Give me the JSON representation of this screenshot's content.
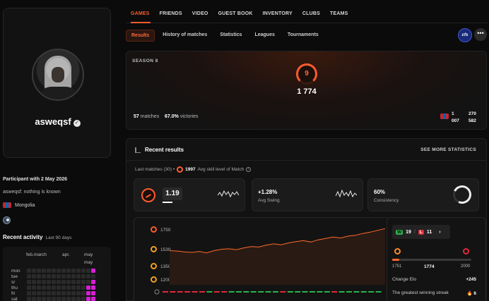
{
  "profile": {
    "username": "asweqsf",
    "participant": "Participant with 2 May 2026",
    "status": "asweqsf: nothing is known",
    "country": "Mongolia"
  },
  "activity": {
    "title": "Recent activity",
    "subtitle": "Last 90 days",
    "months": [
      "feb.march",
      "apr.",
      "may"
    ],
    "month_extra": "may",
    "days": [
      "mon",
      "tue",
      "sr",
      "thu",
      "fri",
      "sat",
      "sun"
    ],
    "accent": "#d61ed6"
  },
  "nav": {
    "items": [
      "GAMES",
      "FRIENDS",
      "VIDEO",
      "GUEST BOOK",
      "INVENTORY",
      "CLUBS",
      "TEAMS"
    ],
    "active_color": "#ff5b2e"
  },
  "subtabs": [
    "Results",
    "History of matches",
    "Statistics",
    "Leagues",
    "Tournaments"
  ],
  "team_logo": "cfs",
  "more_label": "•••",
  "season": {
    "label": "SEASON 8",
    "level": "9",
    "elo": "1 774",
    "matches_value": "57",
    "matches_label": "matches",
    "victories_value": "67.0%",
    "victories_label": "victories",
    "right_line1_a": "1",
    "right_line1_b": "270",
    "right_line2_a": "007",
    "right_line2_b": "582"
  },
  "results": {
    "title": "Recent results",
    "see_more": "SEE MORE STATISTICS",
    "last_matches_prefix": "Last matches (30) •",
    "avg_value": "1997",
    "avg_label": "Avg skill level of Match",
    "elo_card_value": "1.19",
    "swing_value": "+1.28%",
    "swing_label": "Avg Swing",
    "consistency_value": "60%",
    "consistency_label": "Consistency"
  },
  "chart_data": {
    "type": "area",
    "y_ticks": [
      "1750",
      "1530",
      "1350",
      "1200"
    ],
    "ylim": [
      1150,
      1800
    ],
    "values": [
      1530,
      1525,
      1515,
      1510,
      1520,
      1505,
      1530,
      1545,
      1550,
      1540,
      1560,
      1575,
      1570,
      1590,
      1605,
      1595,
      1615,
      1630,
      1640,
      1625,
      1650,
      1665,
      1680,
      1670,
      1690,
      1700,
      1720,
      1735,
      1755,
      1774
    ],
    "results": [
      "L",
      "L",
      "L",
      "L",
      "L",
      "L",
      "W",
      "L",
      "L",
      "W",
      "W",
      "W",
      "W",
      "W",
      "W",
      "W",
      "L",
      "W",
      "W",
      "W",
      "W",
      "W",
      "W",
      "L",
      "W",
      "W",
      "W",
      "W",
      "W",
      "W"
    ],
    "line_color": "#ff6a2a",
    "win_color": "#2bb24c",
    "loss_color": "#e0283a"
  },
  "side": {
    "wins": "19",
    "losses": "11",
    "chevron": "›",
    "range_min": "1751",
    "range_current": "1774",
    "range_max": "2000",
    "range_fraction": 0.09,
    "change_label": "Change Elo",
    "change_value": "+245",
    "streak_label": "The greatest winning streak",
    "streak_value": "6"
  }
}
